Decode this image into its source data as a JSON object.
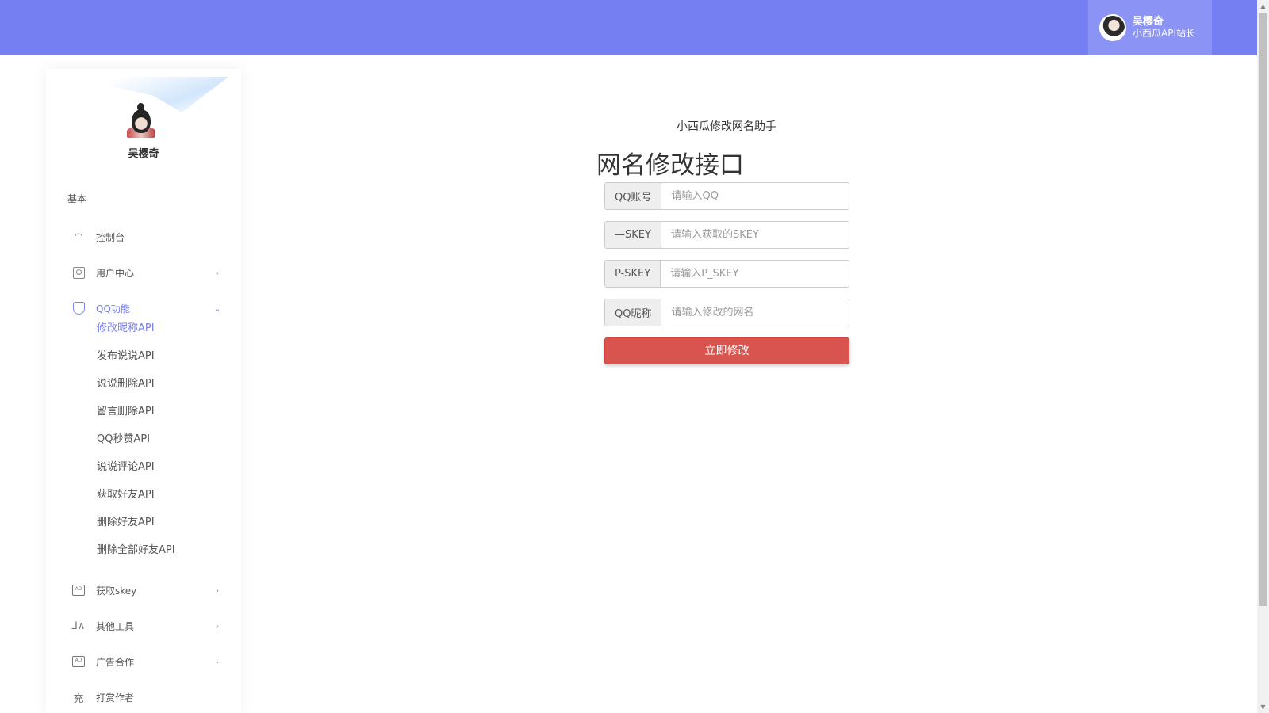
{
  "header": {
    "user_name": "吴樱奇",
    "user_role": "小西瓜API站长"
  },
  "sidebar": {
    "profile_name": "吴樱奇",
    "section_label": "基本",
    "items": [
      {
        "label": "控制台",
        "icon": "dashboard-icon"
      },
      {
        "label": "用户中心",
        "icon": "user-icon"
      },
      {
        "label": "QQ功能",
        "icon": "shield-icon"
      },
      {
        "label": "获取skey",
        "icon": "ad-box-icon"
      },
      {
        "label": "其他工具",
        "icon": "chart-icon"
      },
      {
        "label": "广告合作",
        "icon": "ad-box-icon"
      },
      {
        "label": "打赏作者",
        "icon": "charge-icon"
      }
    ],
    "qq_submenu": [
      "修改昵称API",
      "发布说说API",
      "说说删除API",
      "留言删除API",
      "QQ秒赞API",
      "说说评论API",
      "获取好友API",
      "删除好友API",
      "删除全部好友API"
    ],
    "icon_glyphs": {
      "charge": "充",
      "ad": "AD",
      "chart": "⅃∧"
    }
  },
  "main": {
    "subtitle": "小西瓜修改网名助手",
    "title": "网名修改接口",
    "fields": [
      {
        "label": "QQ账号",
        "placeholder": "请输入QQ"
      },
      {
        "label": "—SKEY",
        "placeholder": "请输入获取的SKEY"
      },
      {
        "label": "P-SKEY",
        "placeholder": "请输入P_SKEY"
      },
      {
        "label": "QQ昵称",
        "placeholder": "请输入修改的网名"
      }
    ],
    "submit_label": "立即修改"
  },
  "colors": {
    "topbar": "#767ff2",
    "accent": "#7a82ee",
    "submit": "#d9534f"
  }
}
